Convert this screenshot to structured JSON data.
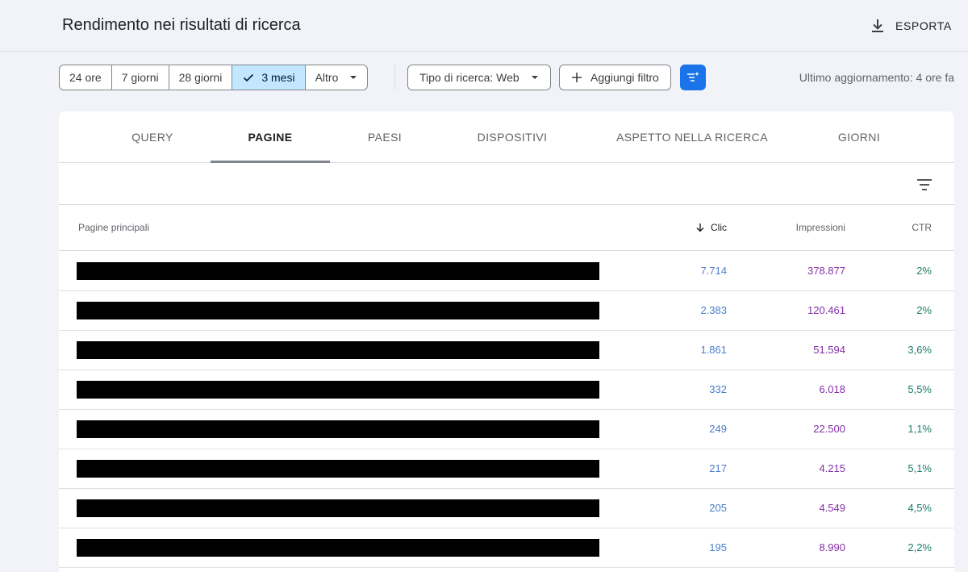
{
  "header": {
    "title": "Rendimento nei risultati di ricerca",
    "export_label": "ESPORTA"
  },
  "toolbar": {
    "date_ranges": [
      "24 ore",
      "7 giorni",
      "28 giorni",
      "3 mesi",
      "Altro"
    ],
    "selected_range": "3 mesi",
    "search_type": "Tipo di ricerca: Web",
    "add_filter": "Aggiungi filtro",
    "last_update": "Ultimo aggiornamento: 4 ore fa"
  },
  "tabs": [
    "QUERY",
    "PAGINE",
    "PAESI",
    "DISPOSITIVI",
    "ASPETTO NELLA RICERCA",
    "GIORNI"
  ],
  "active_tab": "PAGINE",
  "table": {
    "columns": {
      "pages": "Pagine principali",
      "clic": "Clic",
      "impressions": "Impressioni",
      "ctr": "CTR"
    },
    "sorted_by": "Clic",
    "rows": [
      {
        "clic": "7.714",
        "impressions": "378.877",
        "ctr": "2%"
      },
      {
        "clic": "2.383",
        "impressions": "120.461",
        "ctr": "2%"
      },
      {
        "clic": "1.861",
        "impressions": "51.594",
        "ctr": "3,6%"
      },
      {
        "clic": "332",
        "impressions": "6.018",
        "ctr": "5,5%"
      },
      {
        "clic": "249",
        "impressions": "22.500",
        "ctr": "1,1%"
      },
      {
        "clic": "217",
        "impressions": "4.215",
        "ctr": "5,1%"
      },
      {
        "clic": "205",
        "impressions": "4.549",
        "ctr": "4,5%"
      },
      {
        "clic": "195",
        "impressions": "8.990",
        "ctr": "2,2%"
      }
    ]
  },
  "colors": {
    "accent": "#1a73e8",
    "selected_chip": "#c2e7ff",
    "clic": "#4a7fc9",
    "impressions": "#8430a8",
    "ctr": "#1e7d6a"
  }
}
